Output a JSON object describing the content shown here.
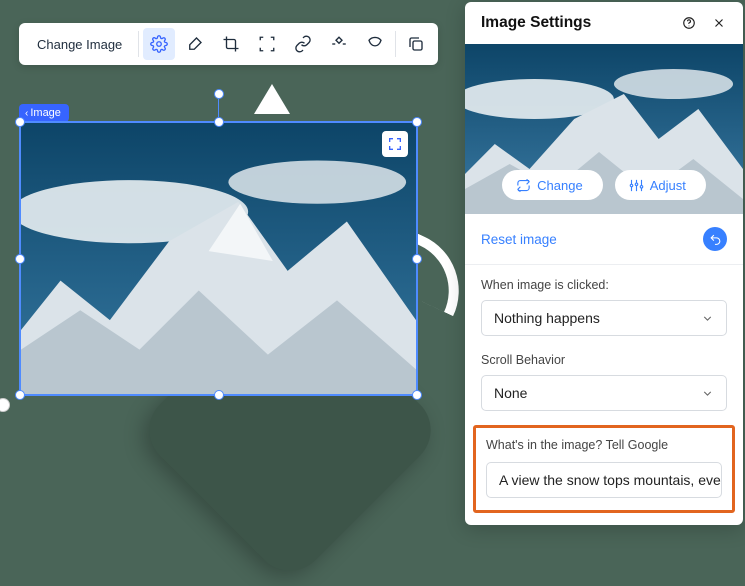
{
  "toolbar": {
    "change_label": "Change Image",
    "icons": [
      "gear-icon",
      "brush-icon",
      "crop-icon",
      "focus-icon",
      "link-icon",
      "animate-icon",
      "mask-icon",
      "copy-icon"
    ]
  },
  "breadcrumb": {
    "label": "Image"
  },
  "panel": {
    "title": "Image Settings",
    "change_btn": "Change",
    "adjust_btn": "Adjust",
    "reset_label": "Reset image",
    "click_section_label": "When image is clicked:",
    "click_value": "Nothing happens",
    "scroll_section_label": "Scroll Behavior",
    "scroll_value": "None",
    "alt_section_label": "What's in the image? Tell Google",
    "alt_value": "A view the snow tops mountais, ever…"
  }
}
